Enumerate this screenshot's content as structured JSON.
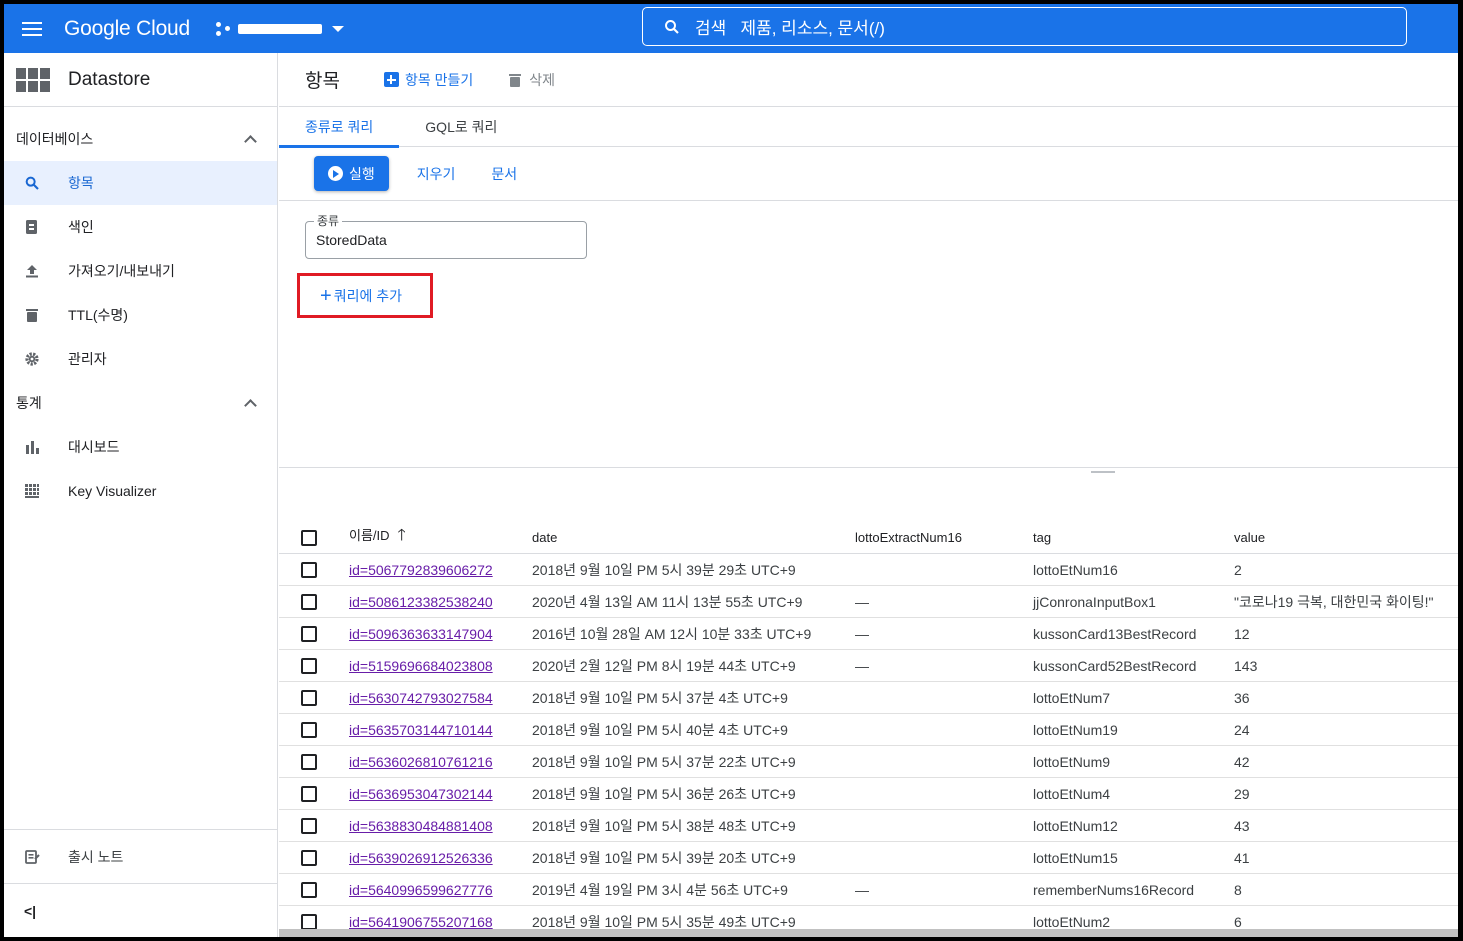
{
  "topbar": {
    "brand": "Google Cloud",
    "search_text": "검색   제품, 리소스, 문서(/)"
  },
  "sidebar": {
    "title": "Datastore",
    "sections": [
      {
        "label": "데이터베이스",
        "items": [
          {
            "label": "항목",
            "icon": "search-icon",
            "active": true
          },
          {
            "label": "색인",
            "icon": "index-icon",
            "active": false
          },
          {
            "label": "가져오기/내보내기",
            "icon": "upload-icon",
            "active": false
          },
          {
            "label": "TTL(수명)",
            "icon": "trash-icon",
            "active": false
          },
          {
            "label": "관리자",
            "icon": "gear-icon",
            "active": false
          }
        ]
      },
      {
        "label": "통계",
        "items": [
          {
            "label": "대시보드",
            "icon": "bar-chart-icon",
            "active": false
          },
          {
            "label": "Key Visualizer",
            "icon": "heatmap-icon",
            "active": false
          }
        ]
      }
    ],
    "release_notes": "출시 노트",
    "collapse": "<|"
  },
  "header": {
    "title": "항목",
    "create": "항목 만들기",
    "delete": "삭제"
  },
  "tabs": [
    "종류로 쿼리",
    "GQL로 쿼리"
  ],
  "actions": {
    "run": "실행",
    "clear": "지우기",
    "docs": "문서"
  },
  "query": {
    "kind_label": "종류",
    "kind_value": "StoredData",
    "add_to_query": "쿼리에 추가"
  },
  "table": {
    "columns": [
      "이름/ID",
      "date",
      "lottoExtractNum16",
      "tag",
      "value"
    ],
    "rows": [
      [
        "id=5067792839606272",
        "2018년 9월 10일 PM 5시 39분 29초 UTC+9",
        "",
        "lottoEtNum16",
        "2"
      ],
      [
        "id=5086123382538240",
        "2020년 4월 13일 AM 11시 13분 55초 UTC+9",
        "—",
        "jjConronaInputBox1",
        "\"코로나19 극복, 대한민국 화이팅!\""
      ],
      [
        "id=5096363633147904",
        "2016년 10월 28일 AM 12시 10분 33초 UTC+9",
        "—",
        "kussonCard13BestRecord",
        "12"
      ],
      [
        "id=5159696684023808",
        "2020년 2월 12일 PM 8시 19분 44초 UTC+9",
        "—",
        "kussonCard52BestRecord",
        "143"
      ],
      [
        "id=5630742793027584",
        "2018년 9월 10일 PM 5시 37분 4초 UTC+9",
        "",
        "lottoEtNum7",
        "36"
      ],
      [
        "id=5635703144710144",
        "2018년 9월 10일 PM 5시 40분 4초 UTC+9",
        "",
        "lottoEtNum19",
        "24"
      ],
      [
        "id=5636026810761216",
        "2018년 9월 10일 PM 5시 37분 22초 UTC+9",
        "",
        "lottoEtNum9",
        "42"
      ],
      [
        "id=5636953047302144",
        "2018년 9월 10일 PM 5시 36분 26초 UTC+9",
        "",
        "lottoEtNum4",
        "29"
      ],
      [
        "id=5638830484881408",
        "2018년 9월 10일 PM 5시 38분 48초 UTC+9",
        "",
        "lottoEtNum12",
        "43"
      ],
      [
        "id=5639026912526336",
        "2018년 9월 10일 PM 5시 39분 20초 UTC+9",
        "",
        "lottoEtNum15",
        "41"
      ],
      [
        "id=5640996599627776",
        "2019년 4월 19일 PM 3시 4분 56초 UTC+9",
        "—",
        "rememberNums16Record",
        "8"
      ],
      [
        "id=5641906755207168",
        "2018년 9월 10일 PM 5시 35분 49초 UTC+9",
        "",
        "lottoEtNum2",
        "6"
      ]
    ]
  },
  "colors": {
    "accent": "#1a73e8",
    "highlight_box": "#e01b24",
    "visited_link": "#681da8"
  }
}
